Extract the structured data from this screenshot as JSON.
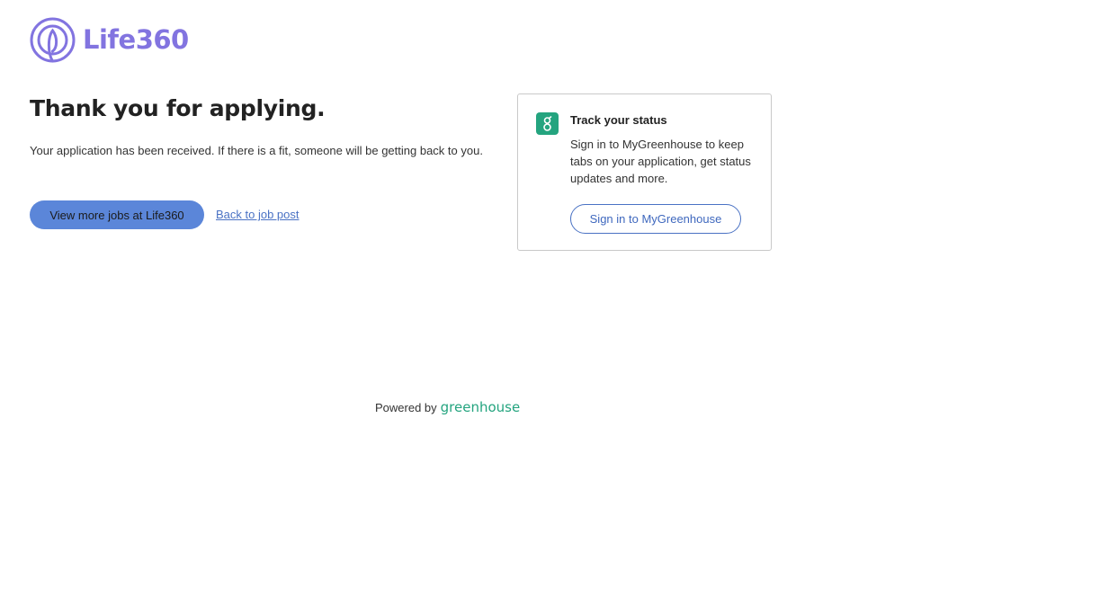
{
  "brand": {
    "name": "Life360",
    "color": "#8274e0"
  },
  "confirmation": {
    "headline": "Thank you for applying.",
    "message": "Your application has been received. If there is a fit, someone will be getting back to you."
  },
  "actions": {
    "view_more_jobs_label": "View more jobs at Life360",
    "back_link_label": "Back to job post"
  },
  "track_card": {
    "title": "Track your status",
    "body": "Sign in to MyGreenhouse to keep tabs on your application, get status updates and more.",
    "sign_in_label": "Sign in to MyGreenhouse",
    "icon": "greenhouse-logo-icon"
  },
  "footer": {
    "powered_by_label": "Powered by",
    "provider_name": "greenhouse",
    "provider_color": "#24a47f"
  }
}
